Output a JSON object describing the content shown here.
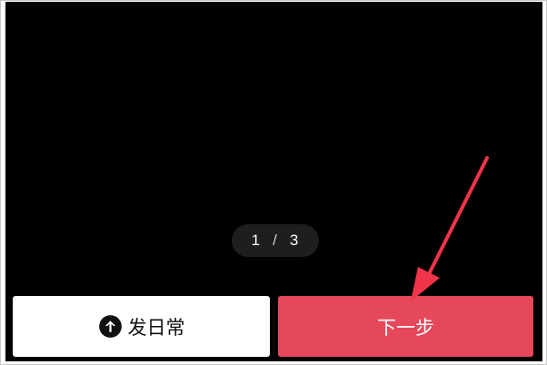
{
  "pager": {
    "current": "1",
    "separator": "/",
    "total": "3"
  },
  "buttons": {
    "post_daily_label": "发日常",
    "next_label": "下一步"
  },
  "icons": {
    "post_daily_icon": "upload-arrow-circle-icon",
    "annotation": "red-arrow-pointer"
  },
  "colors": {
    "screen_background": "#000000",
    "next_button": "#e5475b",
    "annotation_arrow": "#f0344a"
  }
}
